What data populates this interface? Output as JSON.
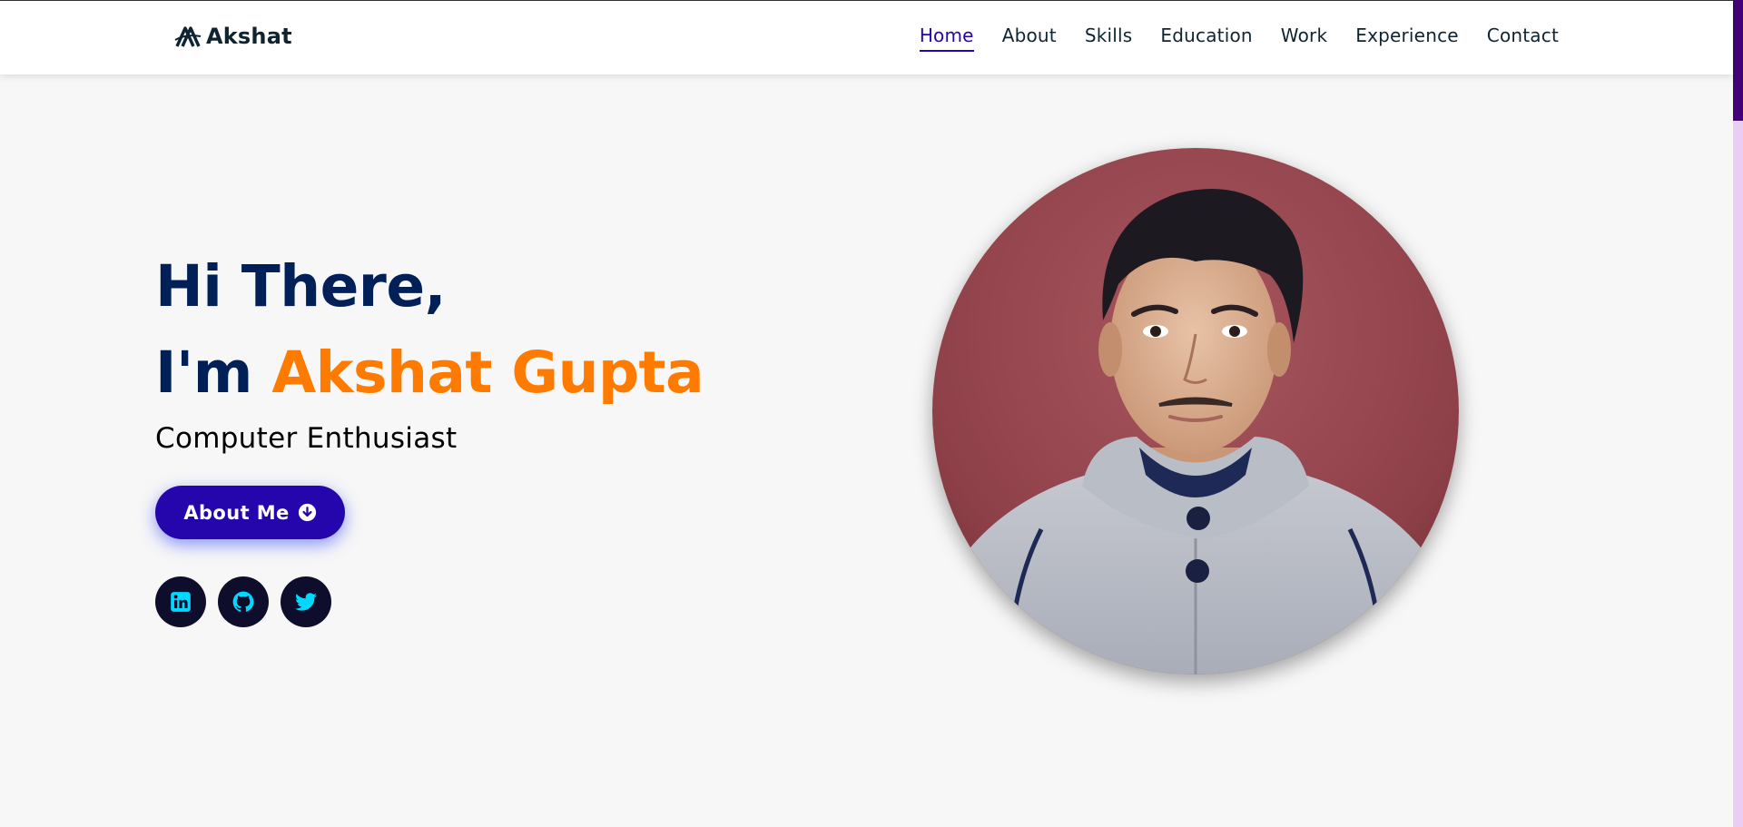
{
  "header": {
    "logo_text": "Akshat",
    "nav": [
      {
        "label": "Home",
        "active": true
      },
      {
        "label": "About",
        "active": false
      },
      {
        "label": "Skills",
        "active": false
      },
      {
        "label": "Education",
        "active": false
      },
      {
        "label": "Work",
        "active": false
      },
      {
        "label": "Experience",
        "active": false
      },
      {
        "label": "Contact",
        "active": false
      }
    ]
  },
  "hero": {
    "greeting": "Hi There,",
    "intro_prefix": "I'm ",
    "name": "Akshat Gupta",
    "subtitle": "Computer Enthusiast",
    "button_label": "About Me",
    "button_icon": "arrow-circle-down-icon",
    "socials": [
      {
        "icon": "linkedin-icon"
      },
      {
        "icon": "github-icon"
      },
      {
        "icon": "twitter-icon"
      }
    ],
    "portrait_icon": "profile-photo"
  },
  "colors": {
    "accent_blue": "#2506ad",
    "heading_navy": "#002057",
    "name_orange": "#ff7b00",
    "social_bg": "#0e0e2c",
    "social_icon": "#00d9ff",
    "scrollbar_track": "#e9cdf2",
    "scrollbar_thumb": "#420177"
  }
}
